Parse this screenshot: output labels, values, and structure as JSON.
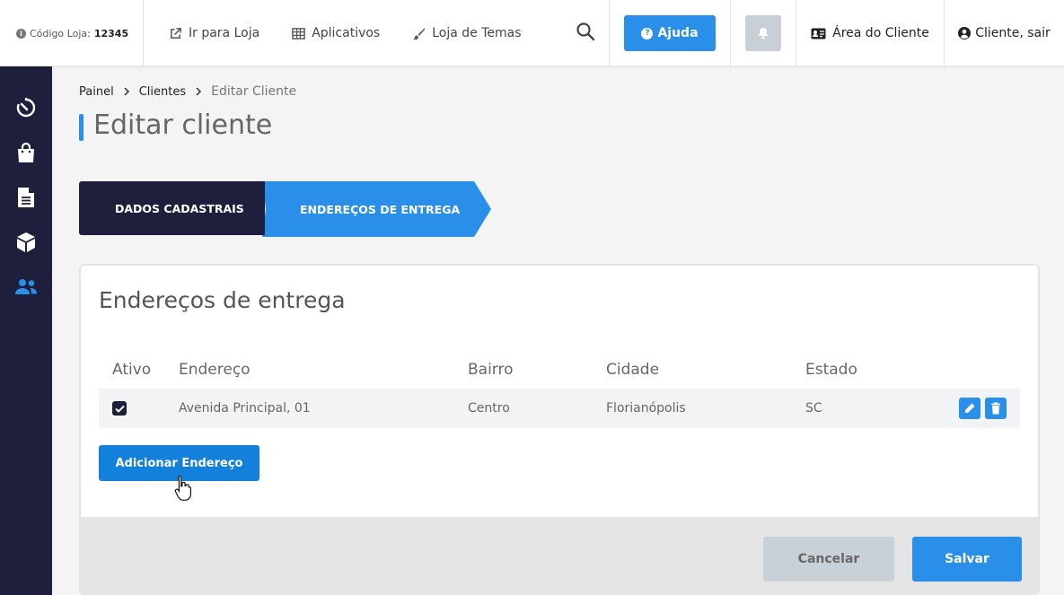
{
  "header": {
    "store_code_label": "Código Loja:",
    "store_code_value": "12345",
    "nav": [
      {
        "label": "Ir para Loja",
        "icon": "external-link-icon"
      },
      {
        "label": "Aplicativos",
        "icon": "grid-icon"
      },
      {
        "label": "Loja de Temas",
        "icon": "brush-icon"
      }
    ],
    "help_label": "Ajuda",
    "client_area_label": "Área do Cliente",
    "logout_label": "Cliente, sair"
  },
  "sidebar": {
    "items": [
      {
        "icon": "dashboard-timer-icon"
      },
      {
        "icon": "shopping-bag-icon"
      },
      {
        "icon": "document-icon"
      },
      {
        "icon": "box-icon"
      },
      {
        "icon": "users-icon",
        "active": true
      }
    ]
  },
  "breadcrumb": {
    "items": [
      "Painel",
      "Clientes"
    ],
    "current": "Editar Cliente"
  },
  "page": {
    "title": "Editar cliente"
  },
  "steps": {
    "step1": "DADOS CADASTRAIS",
    "step2": "ENDEREÇOS DE ENTREGA"
  },
  "addresses": {
    "title": "Endereços de entrega",
    "columns": [
      "Ativo",
      "Endereço",
      "Bairro",
      "Cidade",
      "Estado"
    ],
    "rows": [
      {
        "active": true,
        "address": "Avenida Principal, 01",
        "district": "Centro",
        "city": "Florianópolis",
        "state": "SC"
      }
    ],
    "add_label": "Adicionar Endereço"
  },
  "footer": {
    "cancel_label": "Cancelar",
    "save_label": "Salvar"
  },
  "colors": {
    "accent": "#2a8fe8",
    "sidebar": "#1e1f3d"
  }
}
